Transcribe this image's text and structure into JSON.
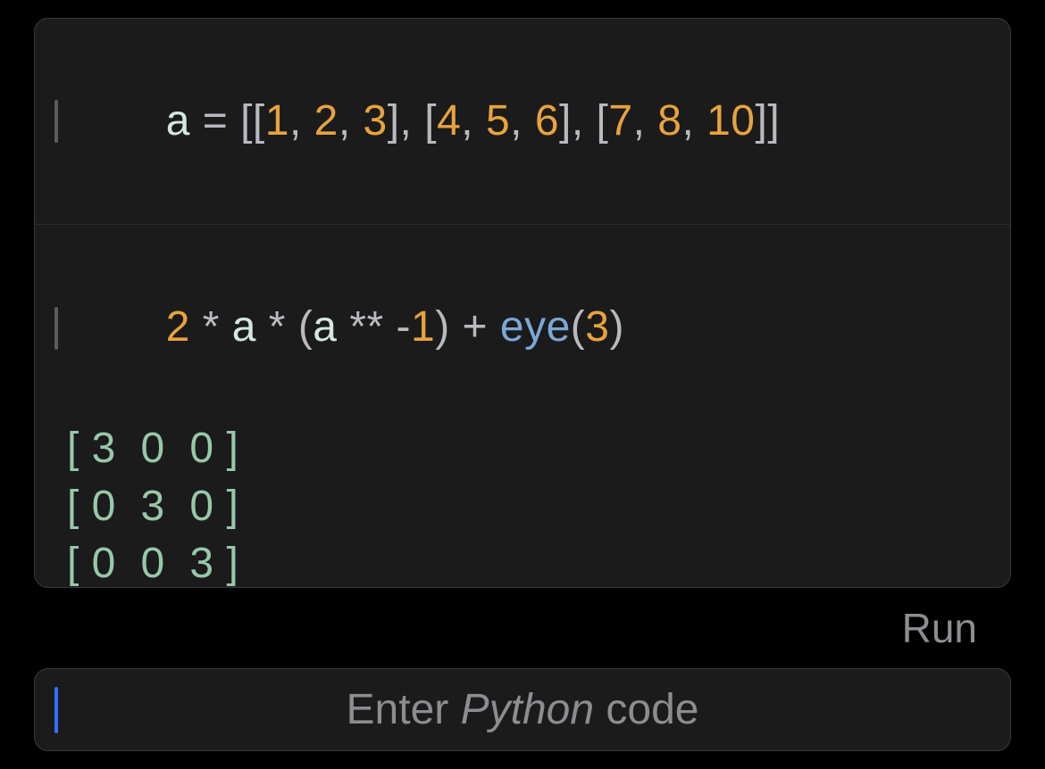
{
  "cell1": {
    "var": "a",
    "eq": " = ",
    "lb1": "[[",
    "n1": "1",
    "c1": ", ",
    "n2": "2",
    "c2": ", ",
    "n3": "3",
    "rb1": "], [",
    "n4": "4",
    "c4": ", ",
    "n5": "5",
    "c5": ", ",
    "n6": "6",
    "rb2": "], [",
    "n7": "7",
    "c7": ", ",
    "n8": "8",
    "c8": ", ",
    "n9": "10",
    "rb3": "]]"
  },
  "cell2": {
    "n1": "2",
    "op1": " * ",
    "var1": "a",
    "op2": " * ",
    "lp": "(",
    "var2": "a",
    "op3": " ** ",
    "neg": "-",
    "n2": "1",
    "rp": ") + ",
    "func": "eye",
    "lp2": "(",
    "n3": "3",
    "rp2": ")",
    "output": "[ 3  0  0 ]\n[ 0  3  0 ]\n[ 0  0  3 ]"
  },
  "run_label": "Run",
  "input": {
    "placeholder_pre": "Enter ",
    "placeholder_lang": "Python",
    "placeholder_post": " code"
  }
}
